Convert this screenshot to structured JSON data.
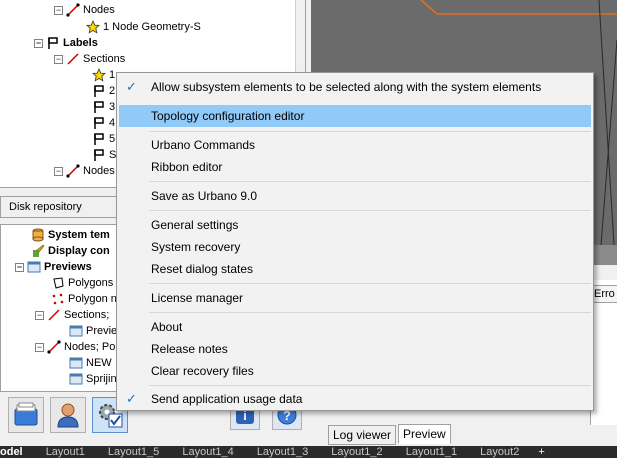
{
  "tree_top": {
    "items": [
      {
        "label": "Nodes",
        "bold": false
      },
      {
        "label": "1 Node Geometry-S",
        "bold": false
      },
      {
        "label": "Labels",
        "bold": true
      },
      {
        "label": "Sections",
        "bold": false
      },
      {
        "label": "1",
        "bold": false
      },
      {
        "label": "2",
        "bold": false
      },
      {
        "label": "3",
        "bold": false
      },
      {
        "label": "4",
        "bold": false
      },
      {
        "label": "5",
        "bold": false
      },
      {
        "label": "ST",
        "bold": false
      },
      {
        "label": "Nodes",
        "bold": false
      }
    ]
  },
  "disk_repository": {
    "label": "Disk repository"
  },
  "tree_bottom": {
    "items": [
      {
        "label": "System tem",
        "bold": true
      },
      {
        "label": "Display con",
        "bold": true
      },
      {
        "label": "Previews",
        "bold": true
      },
      {
        "label": "Polygons",
        "bold": false
      },
      {
        "label": "Polygon n",
        "bold": false
      },
      {
        "label": "Sections;",
        "bold": false
      },
      {
        "label": "Previe",
        "bold": false
      },
      {
        "label": "Nodes; Po",
        "bold": false
      },
      {
        "label": "NEW",
        "bold": false
      },
      {
        "label": "Sprijin",
        "bold": false
      }
    ]
  },
  "right_panel": {
    "error_tab": "Erro",
    "tabs": [
      "Log viewer",
      "Preview"
    ]
  },
  "layout_bar": {
    "tabs": [
      "odel",
      "Layout1",
      "Layout1_5",
      "Layout1_4",
      "Layout1_3",
      "Layout1_2",
      "Layout1_1",
      "Layout2",
      "+"
    ]
  },
  "context_menu": {
    "items": [
      {
        "label": "Allow subsystem elements to be selected along with the system elements",
        "checked": true
      },
      {
        "label": "Topology configuration editor",
        "highlighted": true
      },
      {
        "label": "Urbano Commands"
      },
      {
        "label": "Ribbon editor"
      },
      {
        "label": "Save as Urbano 9.0"
      },
      {
        "label": "General settings"
      },
      {
        "label": "System recovery"
      },
      {
        "label": "Reset dialog states"
      },
      {
        "label": "License manager"
      },
      {
        "label": "About"
      },
      {
        "label": "Release notes"
      },
      {
        "label": "Clear recovery files"
      },
      {
        "label": "Send application usage data",
        "checked": true
      }
    ],
    "check_glyph": "✓"
  },
  "colors": {
    "menu_highlight": "#91c9f7",
    "check": "#1f6fb5",
    "viewport": "#6b6b6b"
  }
}
